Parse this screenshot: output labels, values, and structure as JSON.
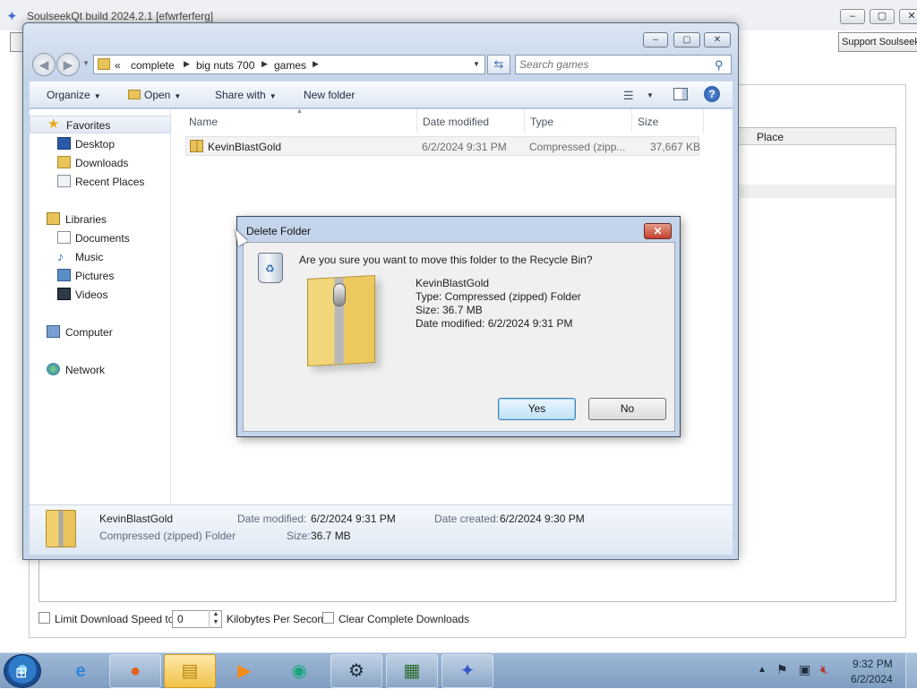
{
  "background_app": {
    "title": "SoulseekQt build 2024.2.1 [efwrferferg]",
    "support_button": "Support Soulseek",
    "place_column": "Place",
    "limit_speed_label": "Limit Download Speed to",
    "speed_value": "0",
    "speed_unit": "Kilobytes Per Second",
    "clear_label": "Clear Complete Downloads"
  },
  "explorer": {
    "breadcrumb": {
      "overflow": "«",
      "segments": [
        "complete",
        "big nuts 700",
        "games"
      ]
    },
    "search_placeholder": "Search games",
    "toolbar": {
      "organize": "Organize",
      "open": "Open",
      "share_with": "Share with",
      "new_folder": "New folder"
    },
    "nav": {
      "favorites": "Favorites",
      "desktop": "Desktop",
      "downloads": "Downloads",
      "recent_places": "Recent Places",
      "libraries": "Libraries",
      "documents": "Documents",
      "music": "Music",
      "pictures": "Pictures",
      "videos": "Videos",
      "computer": "Computer",
      "network": "Network"
    },
    "columns": {
      "name": "Name",
      "date_modified": "Date modified",
      "type": "Type",
      "size": "Size"
    },
    "files": [
      {
        "name": "KevinBlastGold",
        "date_modified": "6/2/2024 9:31 PM",
        "type": "Compressed (zipp...",
        "size": "37,667 KB"
      }
    ],
    "details": {
      "name": "KevinBlastGold",
      "type": "Compressed (zipped) Folder",
      "date_modified_label": "Date modified:",
      "date_modified": "6/2/2024 9:31 PM",
      "date_created_label": "Date created:",
      "date_created": "6/2/2024 9:30 PM",
      "size_label": "Size:",
      "size": "36.7 MB"
    }
  },
  "dialog": {
    "title": "Delete Folder",
    "question": "Are you sure you want to move this folder to the Recycle Bin?",
    "item_name": "KevinBlastGold",
    "item_type": "Type: Compressed (zipped) Folder",
    "item_size": "Size: 36.7 MB",
    "item_date": "Date modified: 6/2/2024 9:31 PM",
    "yes": "Yes",
    "no": "No"
  },
  "taskbar": {
    "clock_time": "9:32 PM",
    "clock_date": "6/2/2024",
    "pinned": [
      "internet-explorer",
      "firefox",
      "windows-explorer",
      "media-player",
      "app-green",
      "steam",
      "system-monitor",
      "soulseek"
    ]
  }
}
